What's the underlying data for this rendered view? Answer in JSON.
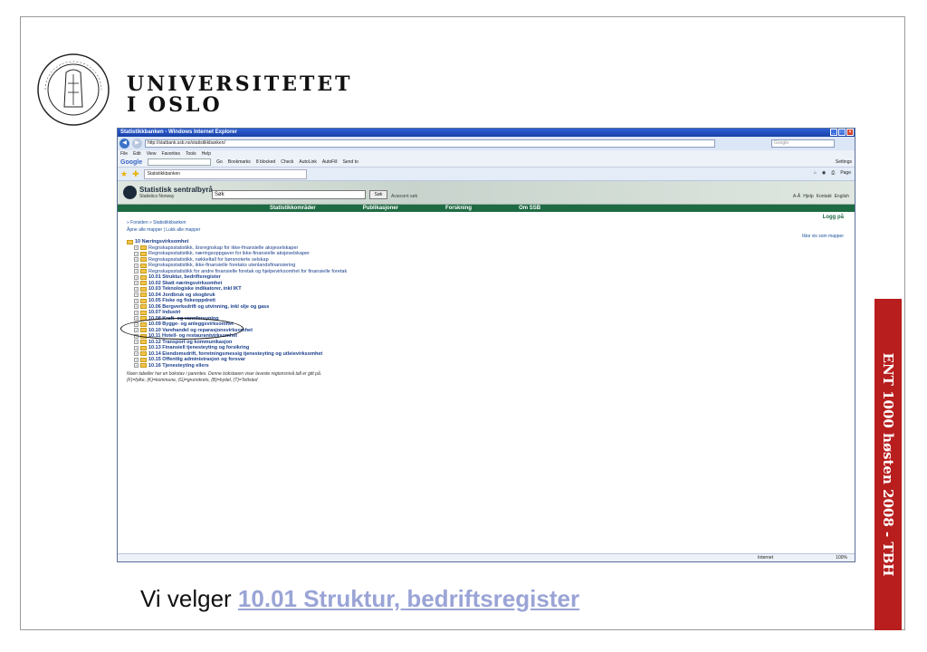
{
  "university": {
    "line1": "UNIVERSITETET",
    "line2": "I OSLO"
  },
  "side_label": "ENT 1000 høsten 2008 - TBH",
  "caption": {
    "prefix": "Vi velger",
    "link": "10.01 Struktur, bedriftsregister"
  },
  "browser": {
    "title": "Statistikkbanken - Windows Internet Explorer",
    "url": "http://statbank.ssb.no/statistikkbanken/",
    "search_placeholder": "Google",
    "menu": [
      "File",
      "Edit",
      "View",
      "Favorites",
      "Tools",
      "Help"
    ],
    "toolbar": {
      "google": "Google",
      "go": "Go",
      "bookmarks": "Bookmarks",
      "blocked": "8 blocked",
      "check": "Check",
      "autolink": "AutoLink",
      "autofill": "AutoFill",
      "sendto": "Send to",
      "settings": "Settings"
    },
    "tab_label": "Statistikkbanken",
    "page_menu": "Page",
    "status_zone": "Internet",
    "zoom": "100%"
  },
  "ssb": {
    "name": "Statistisk sentralbyrå",
    "name_en": "Statistics Norway",
    "search_value": "Søk",
    "search_button": "Søk",
    "advanced": "Avansert søk",
    "top_links": [
      "A-Å",
      "Hjelp",
      "Kontakt",
      "English"
    ],
    "nav": [
      "Statistikkområder",
      "Publikasjoner",
      "Forskning",
      "Om SSB"
    ],
    "login": "Logg på",
    "breadcrumb": "» Forsiden » Statistikkbanken",
    "open_close": "Åpne alle mapper | Lukk alle mapper",
    "not_folders": "Ikke vis som mapper",
    "root": "10 Næringsvirksomhet",
    "subitems": [
      "Regnskapsstatistikk, årsregnskap for ikke-finansielle aksjeselskaper",
      "Regnskapsstatistikk, næringsoppgaver for ikke-finansielle aksjeselskaper",
      "Regnskapsstatistikk, nøkkeltall for børsnoterte selskap",
      "Regnskapsstatistikk, ikke-finansielle foretaks utenlandsfinansiering",
      "Regnskapsstatistikk for andre finansielle foretak og hjelpevirksomhet for finansielle foretak"
    ],
    "categories": [
      "10.01 Struktur, bedriftsregister",
      "10.02 Skatt næringsvirksomhet",
      "10.03 Teknologiske indikatorer, inkl IKT",
      "10.04 Jordbruk og skogbruk",
      "10.05 Fiske og fiskeoppdrett",
      "10.06 Bergverksdrift og utvinning, inkl olje og gass",
      "10.07 Industri",
      "10.08 Kraft- og vannforsyning",
      "10.09 Bygge- og anleggsvirksomhet",
      "10.10 Varehandel og reparasjonsvirksomhet",
      "10.11 Hotell- og restaurantvirksomhet",
      "10.12 Transport og kommunikasjon",
      "10.13 Finansiell tjenesteyting og forsikring",
      "10.14 Eiendomsdrift, forretningsmessig tjenesteyting og utleievirksomhet",
      "10.15 Offentlig administrasjon og forsvar",
      "10.16 Tjenesteyting ellers"
    ],
    "note1": "Noen tabeller har en bokstav i parentes. Denne bokstaven viser laveste regionsnivå tall er gitt på.",
    "note2": "(F)=fylke, (K)=kommune, (G)=grunnkrets, (B)=bydel, (T)=Tettsted"
  },
  "colors": {
    "side_bar": "#b81e1e",
    "ssb_green": "#1e6b43",
    "caption_link": "#9aa4d6"
  }
}
